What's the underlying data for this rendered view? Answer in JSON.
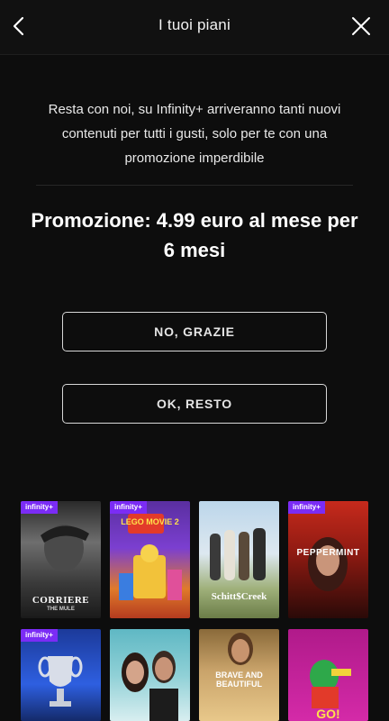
{
  "header": {
    "title": "I tuoi piani",
    "back_icon": "chevron-left-icon",
    "close_icon": "close-icon"
  },
  "message": {
    "line1": "Resta con noi, su Infinity+ arriveranno tanti nuovi",
    "line2": "contenuti per tutti i gusti, solo per te con una",
    "line3": "promozione imperdibile"
  },
  "promo": {
    "line1": "Promozione: 4.99 euro al mese per",
    "line2": "6 mesi"
  },
  "buttons": {
    "decline_label": "NO, GRAZIE",
    "accept_label": "OK, RESTO"
  },
  "posters": [
    {
      "badge": "infinity+",
      "title": "CORRIERE",
      "subtitle": "THE MULE"
    },
    {
      "badge": "infinity+",
      "title": "LEGO MOVIE 2",
      "subtitle": ""
    },
    {
      "badge": "",
      "title": "Schitt$Creek",
      "subtitle": ""
    },
    {
      "badge": "infinity+",
      "title": "PEPPERMINT",
      "subtitle": ""
    },
    {
      "badge": "infinity+",
      "title": "",
      "subtitle": ""
    },
    {
      "badge": "",
      "title": "",
      "subtitle": ""
    },
    {
      "badge": "",
      "title": "BRAVE AND BEAUTIFUL",
      "subtitle": ""
    },
    {
      "badge": "",
      "title": "GO!",
      "subtitle": ""
    }
  ],
  "colors": {
    "background": "#0d0d0d",
    "infinity_badge": "#7b2cf5",
    "button_border": "#d8d8d8"
  }
}
